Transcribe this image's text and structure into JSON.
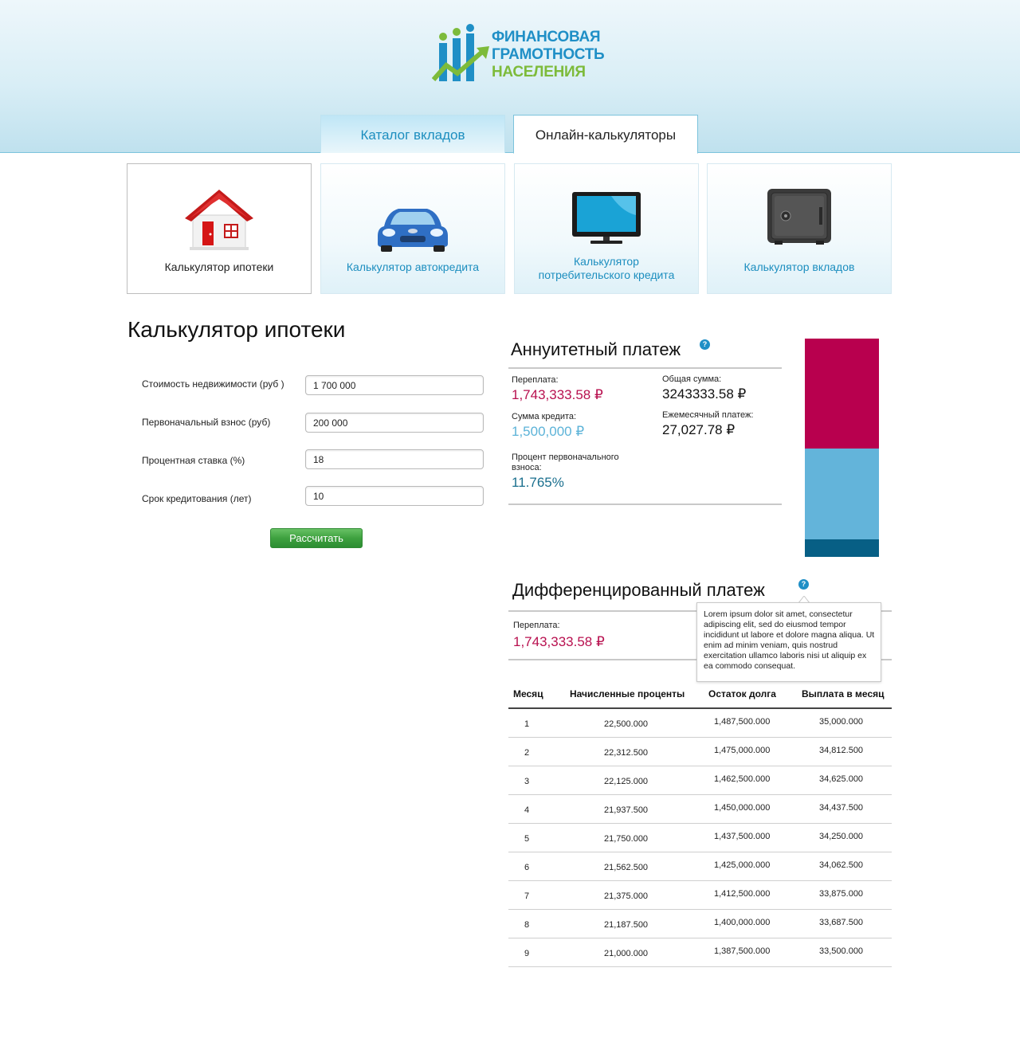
{
  "logo": {
    "line1": "ФИНАНСОВАЯ",
    "line2": "ГРАМОТНОСТЬ",
    "line3": "НАСЕЛЕНИЯ"
  },
  "tabs": [
    {
      "label": "Каталог вкладов"
    },
    {
      "label": "Онлайн-калькуляторы"
    }
  ],
  "cards": [
    {
      "label": "Калькулятор ипотеки",
      "icon": "house-icon"
    },
    {
      "label": "Калькулятор автокредита",
      "icon": "car-icon"
    },
    {
      "label_line1": "Калькулятор",
      "label_line2": "потребительского кредита",
      "icon": "monitor-icon"
    },
    {
      "label": "Калькулятор вкладов",
      "icon": "safe-icon"
    }
  ],
  "form": {
    "title": "Калькулятор ипотеки",
    "fields": [
      {
        "label": "Стоимость недвижимости (руб )",
        "value": "1 700 000"
      },
      {
        "label": "Первоначальный взнос (руб)",
        "value": "200 000"
      },
      {
        "label": "Процентная ставка (%)",
        "value": "18"
      },
      {
        "label": "Срок кредитования (лет)",
        "value": "10"
      }
    ],
    "submit_label": "Рассчитать"
  },
  "annuity": {
    "title": "Аннуитетный платеж",
    "help": "?",
    "overpay_label": "Переплата:",
    "overpay_value": "1,743,333.58 ₽",
    "total_label": "Общая сумма:",
    "total_value": "3243333.58 ₽",
    "credit_label": "Сумма кредита:",
    "credit_value": "1,500,000 ₽",
    "monthly_label": "Ежемесячный платеж:",
    "monthly_value": "27,027.78 ₽",
    "percent_label_line1": "Процент первоначального",
    "percent_label_line2": "взноса:",
    "percent_value": "11.765%"
  },
  "bar": {
    "segments": [
      {
        "name": "overpay",
        "fraction": 0.505,
        "color": "#b8004e"
      },
      {
        "name": "credit",
        "fraction": 0.415,
        "color": "#63b4da"
      },
      {
        "name": "down-payment",
        "fraction": 0.08,
        "color": "#075f85"
      }
    ]
  },
  "differentiated": {
    "title": "Дифференцированный  платеж",
    "help": "?",
    "overpay_label": "Переплата:",
    "overpay_value": "1,743,333.58 ₽",
    "tooltip": "Lorem ipsum dolor sit amet, consectetur adipiscing elit, sed do eiusmod tempor incididunt ut labore et dolore magna aliqua. Ut enim ad minim veniam, quis nostrud exercitation ullamco laboris nisi ut aliquip ex ea commodo consequat."
  },
  "table": {
    "headers": [
      "Месяц",
      "Начисленные проценты",
      "Остаток долга",
      "Выплата в месяц"
    ],
    "rows": [
      [
        "1",
        "22,500.000",
        "1,487,500.000",
        "35,000.000"
      ],
      [
        "2",
        "22,312.500",
        "1,475,000.000",
        "34,812.500"
      ],
      [
        "3",
        "22,125.000",
        "1,462,500.000",
        "34,625.000"
      ],
      [
        "4",
        "21,937.500",
        "1,450,000.000",
        "34,437.500"
      ],
      [
        "5",
        "21,750.000",
        "1,437,500.000",
        "34,250.000"
      ],
      [
        "6",
        "21,562.500",
        "1,425,000.000",
        "34,062.500"
      ],
      [
        "7",
        "21,375.000",
        "1,412,500.000",
        "33,875.000"
      ],
      [
        "8",
        "21,187.500",
        "1,400,000.000",
        "33,687.500"
      ],
      [
        "9",
        "21,000.000",
        "1,387,500.000",
        "33,500.000"
      ]
    ]
  }
}
